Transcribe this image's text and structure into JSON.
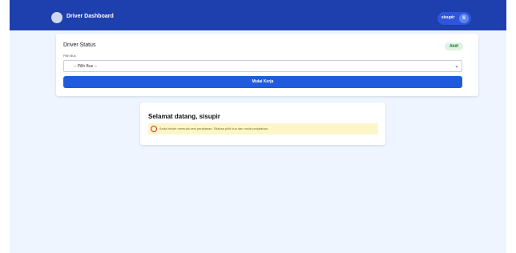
{
  "header": {
    "logo_icon": "driver-logo-icon",
    "title": "Driver Dashboard",
    "user_name": "sisupir",
    "user_initial": "S"
  },
  "status_card": {
    "title": "Driver Status",
    "badge": "Aktif",
    "field_label": "Pilih Bus",
    "select_value": "-- Pilih Bus --",
    "start_button": "Mulai Kerja"
  },
  "welcome_card": {
    "title": "Selamat datang, sisupir",
    "notice_icon": "alert-circle-icon",
    "notice_text": "Anda belum memulai sesi perjalanan. Silakan pilih bus dan mulai perjalanan."
  },
  "colors": {
    "header_bg": "#1e3fae",
    "accent": "#1f5bdc",
    "page_bg": "#eef5ff",
    "badge_bg": "#dff3e3",
    "notice_bg": "#fdf6c9"
  }
}
